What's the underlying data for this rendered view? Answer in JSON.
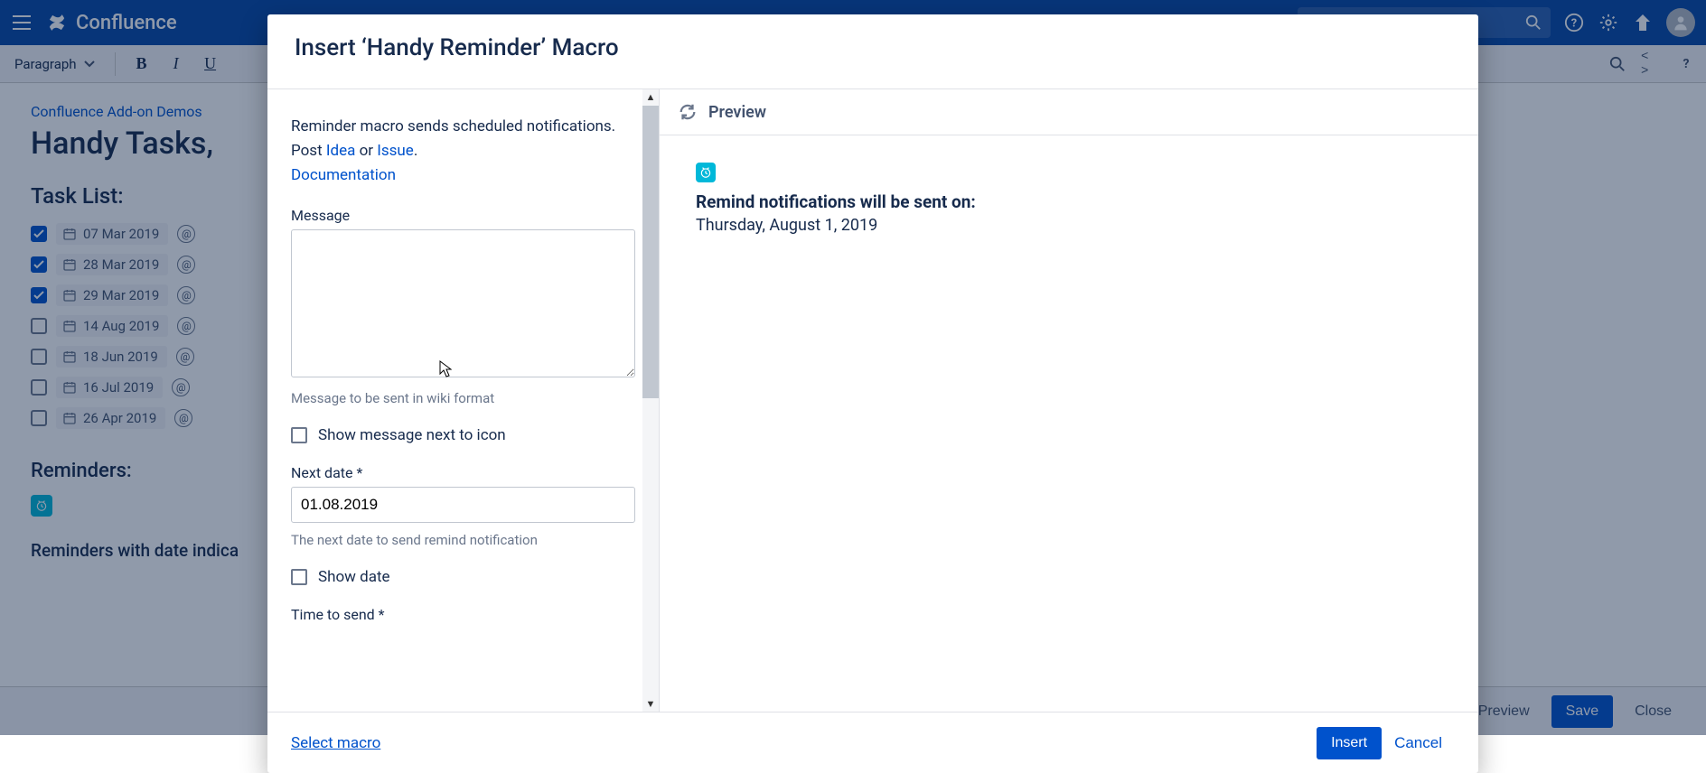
{
  "header": {
    "product": "Confluence"
  },
  "editorBar": {
    "paragraph": "Paragraph",
    "sourceToggle": "< >"
  },
  "page": {
    "breadcrumb": "Confluence Add-on Demos",
    "title": "Handy Tasks,",
    "taskListHeading": "Task List:",
    "tasks": [
      {
        "date": "07 Mar 2019",
        "checked": true
      },
      {
        "date": "28 Mar 2019",
        "checked": true
      },
      {
        "date": "29 Mar 2019",
        "checked": true
      },
      {
        "date": "14 Aug 2019",
        "checked": false
      },
      {
        "date": "18 Jun 2019",
        "checked": false
      },
      {
        "date": "16 Jul 2019",
        "checked": false
      },
      {
        "date": "26 Apr 2019",
        "checked": false
      }
    ],
    "remindersHeading": "Reminders:",
    "sectionTail": "Reminders with date indica"
  },
  "editorActions": {
    "preview": "Preview",
    "save": "Save",
    "close": "Close"
  },
  "modal": {
    "title": "Insert ‘Handy Reminder’ Macro",
    "description": {
      "lead": "Reminder macro sends scheduled notifications. Post ",
      "ideaLink": "Idea",
      "or": " or ",
      "issueLink": "Issue",
      "period": ". ",
      "docLink": "Documentation"
    },
    "messageLabel": "Message",
    "messageHint": "Message to be sent in wiki format",
    "showMessageLabel": "Show message next to icon",
    "nextDateLabel": "Next date *",
    "nextDateValue": "01.08.2019",
    "nextDateHint": "The next date to send remind notification",
    "showDateLabel": "Show date",
    "timeToSendLabel": "Time to send *",
    "preview": {
      "heading": "Preview",
      "title": "Remind notifications will be sent on:",
      "date": "Thursday, August 1, 2019"
    },
    "footer": {
      "selectMacro": "Select macro",
      "insert": "Insert",
      "cancel": "Cancel"
    }
  }
}
